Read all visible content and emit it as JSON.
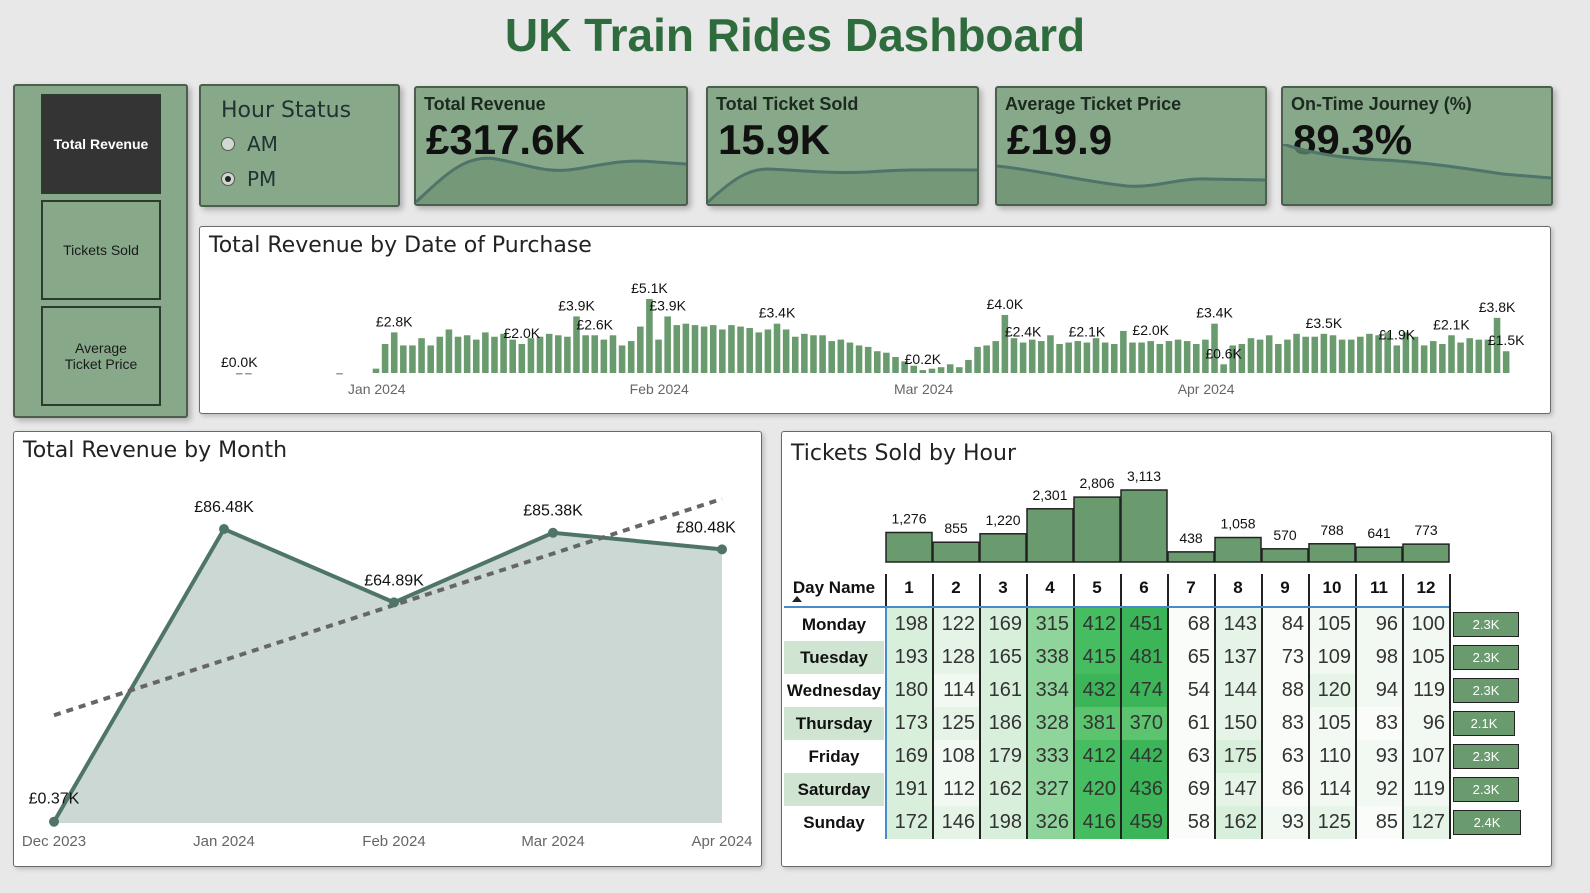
{
  "title": "UK Train Rides Dashboard",
  "nav": {
    "items": [
      {
        "label": "Total Revenue",
        "active": true
      },
      {
        "label": "Tickets Sold",
        "active": false
      },
      {
        "label": "Average Ticket Price",
        "active": false
      }
    ]
  },
  "hour_status": {
    "title": "Hour Status",
    "options": [
      {
        "label": "AM",
        "selected": false
      },
      {
        "label": "PM",
        "selected": true
      }
    ]
  },
  "kpis": [
    {
      "label": "Total Revenue",
      "value": "£317.6K"
    },
    {
      "label": "Total Ticket Sold",
      "value": "15.9K"
    },
    {
      "label": "Average Ticket Price",
      "value": "£19.9"
    },
    {
      "label": "On-Time Journey (%)",
      "value": "89.3%"
    }
  ],
  "colors": {
    "accent": "#2e6b3d",
    "card_green": "#87a98a",
    "bar_green": "#6a9b6e",
    "line": "#4f7469",
    "area": "#cbd8d4"
  },
  "chart_data": [
    {
      "type": "bar",
      "title": "Total Revenue by Date of Purchase",
      "xlabel": "",
      "ylabel": "",
      "x_ticks": [
        "Jan 2024",
        "Feb 2024",
        "Mar 2024",
        "Apr 2024"
      ],
      "values": [
        0.0,
        0.0,
        0.0,
        0.0,
        0.0,
        0.0,
        0.0,
        0.0,
        0.0,
        0.0,
        0.0,
        0.0,
        0.0,
        0.0,
        0.0,
        0.3,
        2.0,
        2.8,
        1.9,
        1.9,
        2.4,
        1.9,
        2.5,
        3.0,
        2.5,
        2.6,
        2.3,
        2.8,
        2.5,
        2.7,
        2.3,
        2.0,
        2.4,
        2.5,
        2.7,
        2.6,
        2.5,
        3.9,
        2.6,
        2.6,
        2.3,
        2.6,
        1.9,
        2.2,
        3.2,
        5.1,
        2.3,
        3.9,
        3.3,
        3.4,
        3.3,
        3.2,
        3.3,
        3.0,
        3.3,
        3.2,
        3.1,
        2.8,
        3.0,
        3.4,
        3.0,
        2.5,
        2.7,
        2.6,
        2.6,
        2.2,
        2.3,
        2.1,
        1.9,
        1.8,
        1.5,
        1.4,
        1.1,
        0.8,
        0.5,
        0.2,
        0.3,
        0.4,
        0.6,
        0.4,
        0.9,
        1.8,
        1.9,
        2.2,
        4.0,
        2.4,
        2.1,
        2.3,
        2.2,
        2.6,
        2.0,
        2.1,
        2.2,
        2.1,
        2.4,
        2.1,
        2.0,
        2.9,
        2.1,
        2.1,
        2.2,
        2.0,
        2.2,
        2.3,
        2.2,
        2.0,
        2.3,
        3.4,
        0.6,
        1.9,
        2.0,
        2.4,
        2.3,
        2.6,
        2.0,
        2.3,
        2.7,
        2.5,
        2.5,
        2.7,
        2.6,
        2.3,
        2.3,
        2.5,
        2.7,
        2.6,
        2.8,
        1.9,
        2.8,
        2.5,
        1.9,
        2.2,
        2.0,
        2.6,
        2.1,
        2.4,
        2.3,
        2.3,
        3.8,
        1.5
      ],
      "data_labels": [
        {
          "x_index": 0,
          "text": "£0.0K"
        },
        {
          "x_index": 17,
          "text": "£2.8K"
        },
        {
          "x_index": 37,
          "text": "£3.9K"
        },
        {
          "x_index": 31,
          "text": "£2.0K"
        },
        {
          "x_index": 39,
          "text": "£2.6K"
        },
        {
          "x_index": 45,
          "text": "£5.1K"
        },
        {
          "x_index": 47,
          "text": "£3.9K"
        },
        {
          "x_index": 59,
          "text": "£3.4K"
        },
        {
          "x_index": 75,
          "text": "£0.2K"
        },
        {
          "x_index": 84,
          "text": "£4.0K"
        },
        {
          "x_index": 86,
          "text": "£2.4K"
        },
        {
          "x_index": 93,
          "text": "£2.1K"
        },
        {
          "x_index": 100,
          "text": "£2.0K"
        },
        {
          "x_index": 107,
          "text": "£3.4K"
        },
        {
          "x_index": 108,
          "text": "£0.6K"
        },
        {
          "x_index": 119,
          "text": "£3.5K"
        },
        {
          "x_index": 127,
          "text": "£1.9K"
        },
        {
          "x_index": 133,
          "text": "£2.1K"
        },
        {
          "x_index": 138,
          "text": "£3.8K"
        },
        {
          "x_index": 139,
          "text": "£1.5K"
        }
      ]
    },
    {
      "type": "area",
      "title": "Total Revenue by Month",
      "xlabel": "",
      "ylabel": "",
      "categories": [
        "Dec 2023",
        "Jan 2024",
        "Feb 2024",
        "Mar 2024",
        "Apr 2024"
      ],
      "values": [
        0.37,
        86.48,
        64.89,
        85.38,
        80.48
      ],
      "data_labels": [
        "£0.37K",
        "£86.48K",
        "£64.89K",
        "£85.38K",
        "£80.48K"
      ],
      "trendline": true
    },
    {
      "type": "bar",
      "title": "Tickets Sold by Hour",
      "categories": [
        "1",
        "2",
        "3",
        "4",
        "5",
        "6",
        "7",
        "8",
        "9",
        "10",
        "11",
        "12"
      ],
      "values": [
        1276,
        855,
        1220,
        2301,
        2806,
        3113,
        438,
        1058,
        570,
        788,
        641,
        773
      ],
      "data_labels": [
        "1,276",
        "855",
        "1,220",
        "2,301",
        "2,806",
        "3,113",
        "438",
        "1,058",
        "570",
        "788",
        "641",
        "773"
      ]
    },
    {
      "type": "heatmap",
      "title": "Tickets Sold by Hour",
      "row_header": "Day Name",
      "columns": [
        "1",
        "2",
        "3",
        "4",
        "5",
        "6",
        "7",
        "8",
        "9",
        "10",
        "11",
        "12"
      ],
      "rows": [
        {
          "day": "Monday",
          "values": [
            198,
            122,
            169,
            315,
            412,
            451,
            68,
            143,
            84,
            105,
            96,
            100
          ],
          "total": "2.3K"
        },
        {
          "day": "Tuesday",
          "values": [
            193,
            128,
            165,
            338,
            415,
            481,
            65,
            137,
            73,
            109,
            98,
            105
          ],
          "total": "2.3K"
        },
        {
          "day": "Wednesday",
          "values": [
            180,
            114,
            161,
            334,
            432,
            474,
            54,
            144,
            88,
            120,
            94,
            119
          ],
          "total": "2.3K"
        },
        {
          "day": "Thursday",
          "values": [
            173,
            125,
            186,
            328,
            381,
            370,
            61,
            150,
            83,
            105,
            83,
            96
          ],
          "total": "2.1K"
        },
        {
          "day": "Friday",
          "values": [
            169,
            108,
            179,
            333,
            412,
            442,
            63,
            175,
            63,
            110,
            93,
            107
          ],
          "total": "2.3K"
        },
        {
          "day": "Saturday",
          "values": [
            191,
            112,
            162,
            327,
            420,
            436,
            69,
            147,
            86,
            114,
            92,
            119
          ],
          "total": "2.3K"
        },
        {
          "day": "Sunday",
          "values": [
            172,
            146,
            198,
            326,
            416,
            459,
            58,
            162,
            93,
            125,
            85,
            127
          ],
          "total": "2.4K"
        }
      ]
    }
  ]
}
